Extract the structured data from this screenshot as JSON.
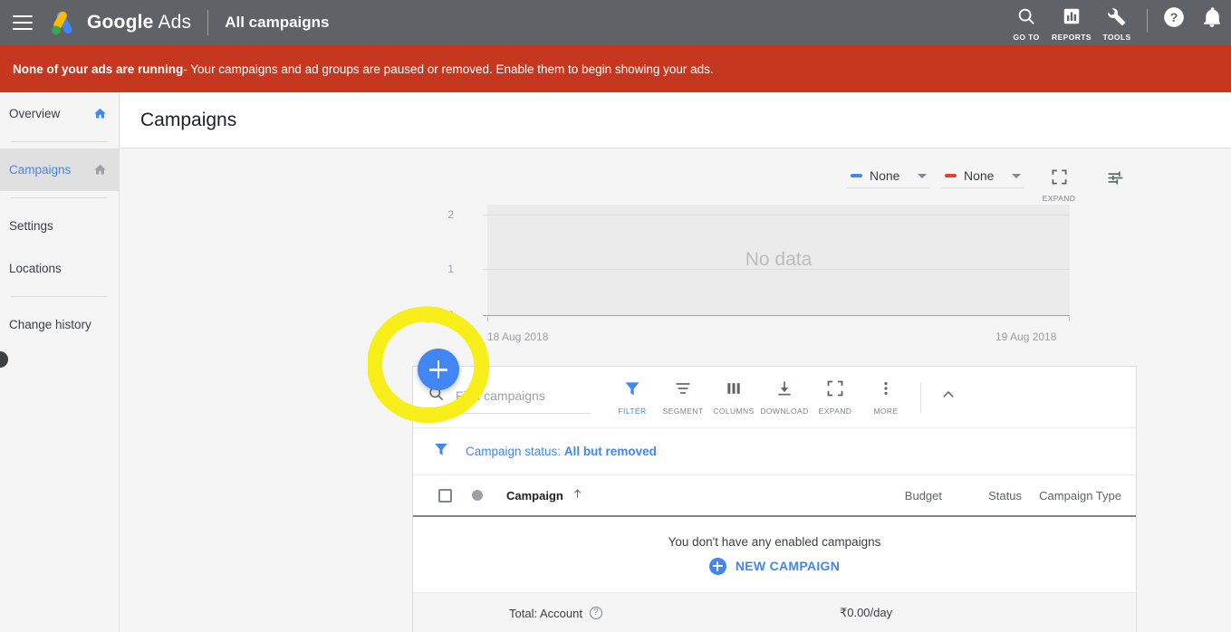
{
  "topbar": {
    "menu_icon": "hamburger-menu-icon",
    "logo_icon": "google-ads-logo",
    "brand_google": "Google",
    "brand_ads": "Ads",
    "section_title": "All campaigns",
    "actions": [
      {
        "icon": "search-icon",
        "label": "GO TO"
      },
      {
        "icon": "reports-bar-chart-icon",
        "label": "REPORTS"
      },
      {
        "icon": "wrench-tools-icon",
        "label": "TOOLS"
      }
    ],
    "help_icon": "help-question-icon",
    "notifications_icon": "bell-notification-icon",
    "background": "#5f6368"
  },
  "alert": {
    "strong": "None of your ads are running",
    "rest": " - Your campaigns and ad groups are paused or removed. Enable them to begin showing your ads.",
    "background": "#c5371f"
  },
  "sidebar": {
    "items": [
      {
        "label": "Overview",
        "icon": "home-icon",
        "icon_color": "#4285f4",
        "active": false
      },
      {
        "label": "Campaigns",
        "icon": "home-icon",
        "icon_color": "#9aa0a6",
        "active": true
      },
      {
        "label": "Settings",
        "icon": "",
        "active": false
      },
      {
        "label": "Locations",
        "icon": "",
        "active": false
      },
      {
        "label": "Change history",
        "icon": "",
        "active": false
      }
    ],
    "active_color": "#4285f4"
  },
  "page": {
    "title": "Campaigns"
  },
  "chart_controls": {
    "metric_1": {
      "name": "None",
      "color": "#4285f4"
    },
    "metric_2": {
      "name": "None",
      "color": "#db4437"
    },
    "expand": {
      "icon": "expand-icon",
      "label": "EXPAND"
    },
    "tune": {
      "icon": "tune-sliders-icon",
      "label": ""
    }
  },
  "chart_data": {
    "type": "line",
    "title": "",
    "xlabel": "",
    "ylabel": "",
    "empty_message": "No data",
    "series": [
      {
        "name": "None",
        "color": "#4285f4",
        "values": []
      },
      {
        "name": "None",
        "color": "#db4437",
        "values": []
      }
    ],
    "x": [
      "18 Aug 2018",
      "19 Aug 2018"
    ],
    "xtick_labels": [
      "18 Aug 2018",
      "19 Aug 2018"
    ],
    "ytick_labels": [
      "0",
      "1",
      "2"
    ],
    "ylim": [
      0,
      2
    ],
    "grid": true,
    "legend_position": "top-right"
  },
  "toolbar": {
    "search_placeholder": "Find campaigns",
    "search_value": "",
    "search_icon": "search-icon",
    "items": [
      {
        "icon": "filter-funnel-icon",
        "label": "FILTER",
        "highlighted": true
      },
      {
        "icon": "segment-lines-icon",
        "label": "SEGMENT",
        "highlighted": false
      },
      {
        "icon": "columns-icon",
        "label": "COLUMNS",
        "highlighted": false
      },
      {
        "icon": "download-icon",
        "label": "DOWNLOAD",
        "highlighted": false
      },
      {
        "icon": "expand-icon",
        "label": "EXPAND",
        "highlighted": false
      },
      {
        "icon": "more-vertical-dots-icon",
        "label": "MORE",
        "highlighted": false
      }
    ],
    "collapse_icon": "chevron-up-icon"
  },
  "filter_row": {
    "icon": "filter-funnel-icon",
    "prefix": "Campaign status: ",
    "value": "All but removed"
  },
  "table": {
    "select_all_checkbox": "unchecked",
    "status_dot_header": "status-dot",
    "columns": [
      {
        "label": "Campaign",
        "sorted": true,
        "sort_icon": "arrow-up-icon"
      },
      {
        "label": "Budget"
      },
      {
        "label": "Status"
      },
      {
        "label": "Campaign Type"
      }
    ],
    "empty_message": "You don't have any enabled campaigns",
    "new_campaign_label": "NEW CAMPAIGN",
    "total_label": "Total: Account",
    "total_help_icon": "help-question-icon",
    "total_value": "₹0.00/day"
  },
  "fab": {
    "icon": "plus-icon",
    "color": "#4285f4",
    "label": ""
  },
  "annotation": {
    "shape": "hand-drawn-yellow-circle",
    "color": "#f7ee1a"
  }
}
